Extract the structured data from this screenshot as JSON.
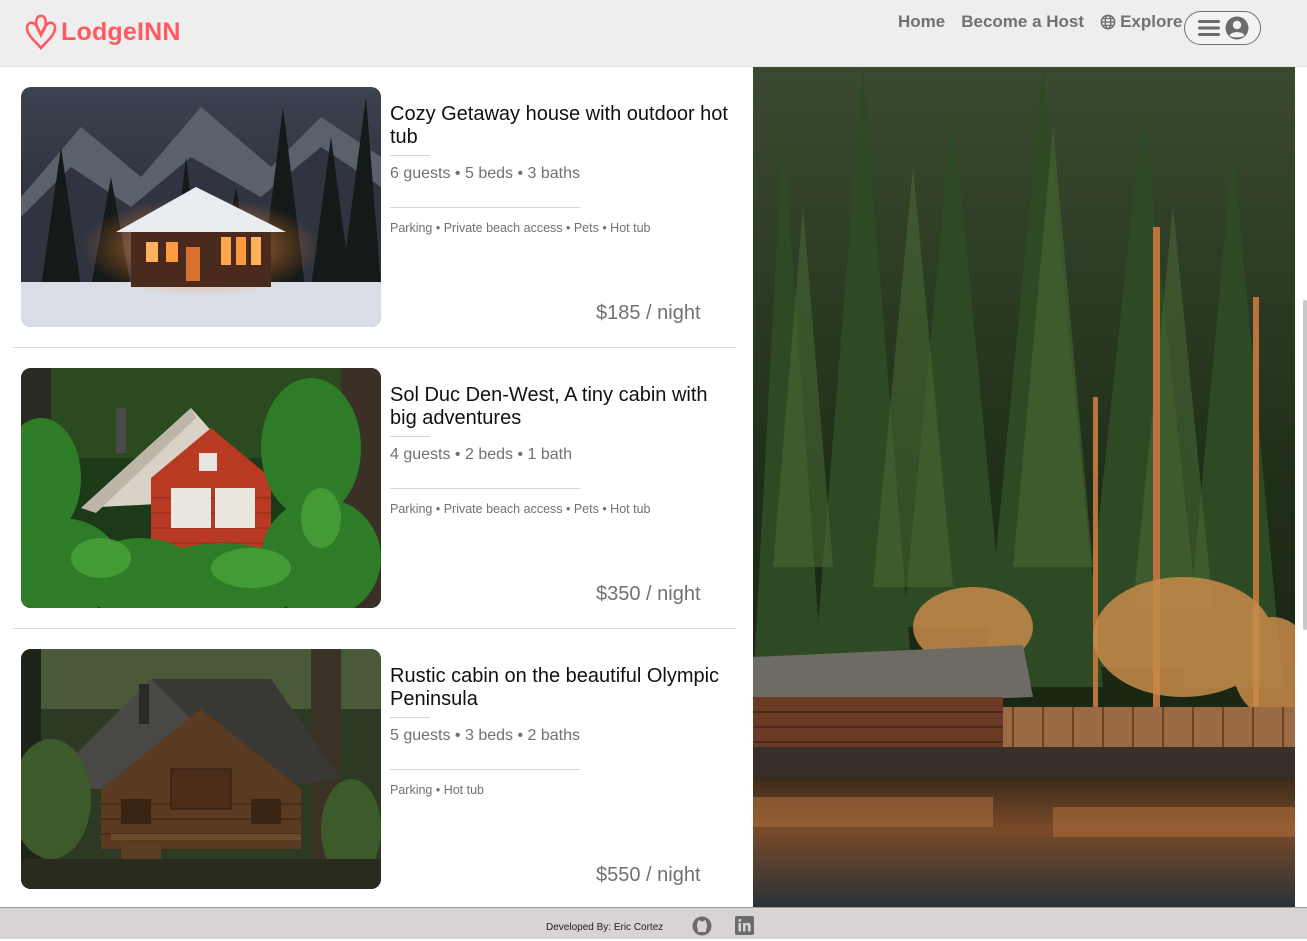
{
  "header": {
    "brand": "LodgeINN",
    "brand_color": "#ff5a5f",
    "nav": {
      "home": "Home",
      "become_host": "Become a Host",
      "explore": "Explore"
    },
    "icons": {
      "logo": "airbnb-logo-icon",
      "globe": "globe-icon",
      "menu": "hamburger-icon",
      "user": "user-circle-icon"
    }
  },
  "listings": [
    {
      "title": "Cozy Getaway house with outdoor hot tub",
      "specs": "6 guests • 5 beds • 3 baths",
      "amenities": "Parking • Private beach access • Pets • Hot tub",
      "price": "$185 / night"
    },
    {
      "title": "Sol Duc Den-West, A tiny cabin with big adventures",
      "specs": "4 guests • 2 beds • 1 bath",
      "amenities": "Parking • Private beach access • Pets • Hot tub",
      "price": "$350 / night"
    },
    {
      "title": "Rustic cabin on the beautiful Olympic Peninsula",
      "specs": "5 guests • 3 beds • 2 baths",
      "amenities": "Parking • Hot tub",
      "price": "$550 / night"
    }
  ],
  "footer": {
    "credit": "Developed By: Eric Cortez",
    "icons": {
      "github": "github-icon",
      "linkedin": "linkedin-icon"
    }
  }
}
